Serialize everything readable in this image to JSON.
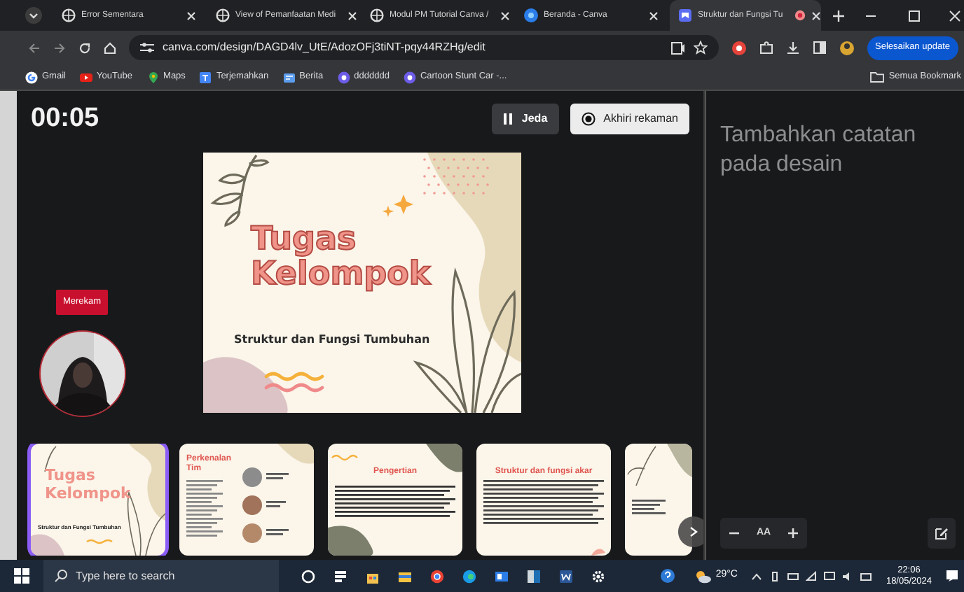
{
  "browser": {
    "tabs": [
      {
        "title": "Error Sementara",
        "selected": false
      },
      {
        "title": "View of Pemanfaatan Medi",
        "selected": false
      },
      {
        "title": "Modul PM Tutorial Canva /",
        "selected": false
      },
      {
        "title": "Beranda - Canva",
        "selected": false
      },
      {
        "title": "Struktur dan Fungsi Tu",
        "selected": true
      }
    ],
    "url": "canva.com/design/DAGD4lv_UtE/AdozOFj3tiNT-pqy44RZHg/edit",
    "update_button": "Selesaikan update",
    "bookmarks": [
      "Gmail",
      "YouTube",
      "Maps",
      "Terjemahkan",
      "Berita",
      "ddddddd",
      "Cartoon Stunt Car -..."
    ],
    "all_bookmarks": "Semua Bookmark"
  },
  "recording": {
    "timer": "00:05",
    "pause_button": "Jeda",
    "end_button": "Akhiri rekaman",
    "badge": "Merekam"
  },
  "slide": {
    "title_lines": [
      "Tugas",
      "Kelompok"
    ],
    "subtitle": "Struktur dan Fungsi Tumbuhan"
  },
  "thumbnails": [
    {
      "kind": "cover",
      "title": "Tugas Kelompok",
      "subtitle": "Struktur dan Fungsi Tumbuhan",
      "selected": true
    },
    {
      "kind": "team",
      "title": "Perkenalan Tim",
      "selected": false
    },
    {
      "kind": "text",
      "title": "Pengertian",
      "selected": false
    },
    {
      "kind": "text",
      "title": "Struktur dan fungsi akar",
      "selected": false
    },
    {
      "kind": "partial",
      "selected": false
    }
  ],
  "notes": {
    "placeholder": "Tambahkan catatan pada desain",
    "font_size_label": "AA"
  },
  "taskbar": {
    "search_placeholder": "Type here to search",
    "weather": "29°C",
    "time": "22:06",
    "date": "18/05/2024"
  }
}
